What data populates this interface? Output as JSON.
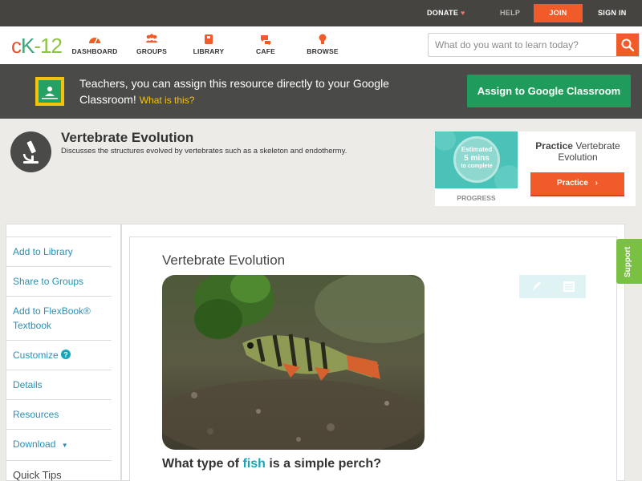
{
  "topbar": {
    "donate": "DONATE",
    "help": "HELP",
    "join": "JOIN",
    "signin": "SIGN IN"
  },
  "logo": {
    "c": "c",
    "k": "K",
    "n": "-12"
  },
  "nav": {
    "items": [
      {
        "label": "DASHBOARD",
        "icon": "dashboard-icon"
      },
      {
        "label": "GROUPS",
        "icon": "groups-icon"
      },
      {
        "label": "LIBRARY",
        "icon": "library-icon"
      },
      {
        "label": "CAFE",
        "icon": "cafe-icon"
      },
      {
        "label": "BROWSE",
        "icon": "browse-icon"
      }
    ]
  },
  "search": {
    "placeholder": "What do you want to learn today?"
  },
  "banner": {
    "text": "Teachers, you can assign this resource directly to your Google Classroom!",
    "what": "What is this?",
    "button": "Assign to Google Classroom"
  },
  "header": {
    "title": "Vertebrate Evolution",
    "description": "Discusses the structures evolved by vertebrates such as a skeleton and endothermy."
  },
  "practice": {
    "estimated": "Estimated",
    "mins": "5 mins",
    "to_complete": "to complete",
    "progress_label": "PROGRESS",
    "title_bold": "Practice",
    "title_rest": "Vertebrate Evolution",
    "button": "Practice"
  },
  "sidebar": {
    "items": [
      {
        "label": "Add to Library"
      },
      {
        "label": "Share to Groups"
      },
      {
        "label": "Add to FlexBook® Textbook"
      },
      {
        "label": "Customize"
      },
      {
        "label": "Details"
      },
      {
        "label": "Resources"
      },
      {
        "label": "Download"
      },
      {
        "label": "Quick Tips"
      }
    ]
  },
  "article": {
    "title": "Vertebrate Evolution",
    "question_pre": "What type of",
    "question_link": "fish",
    "question_post": "is a simple perch?"
  },
  "support": "Support",
  "colors": {
    "accent": "#f15b2a",
    "green": "#1f9c5b",
    "teal": "#16a8b8",
    "link": "#2b8fb5"
  }
}
